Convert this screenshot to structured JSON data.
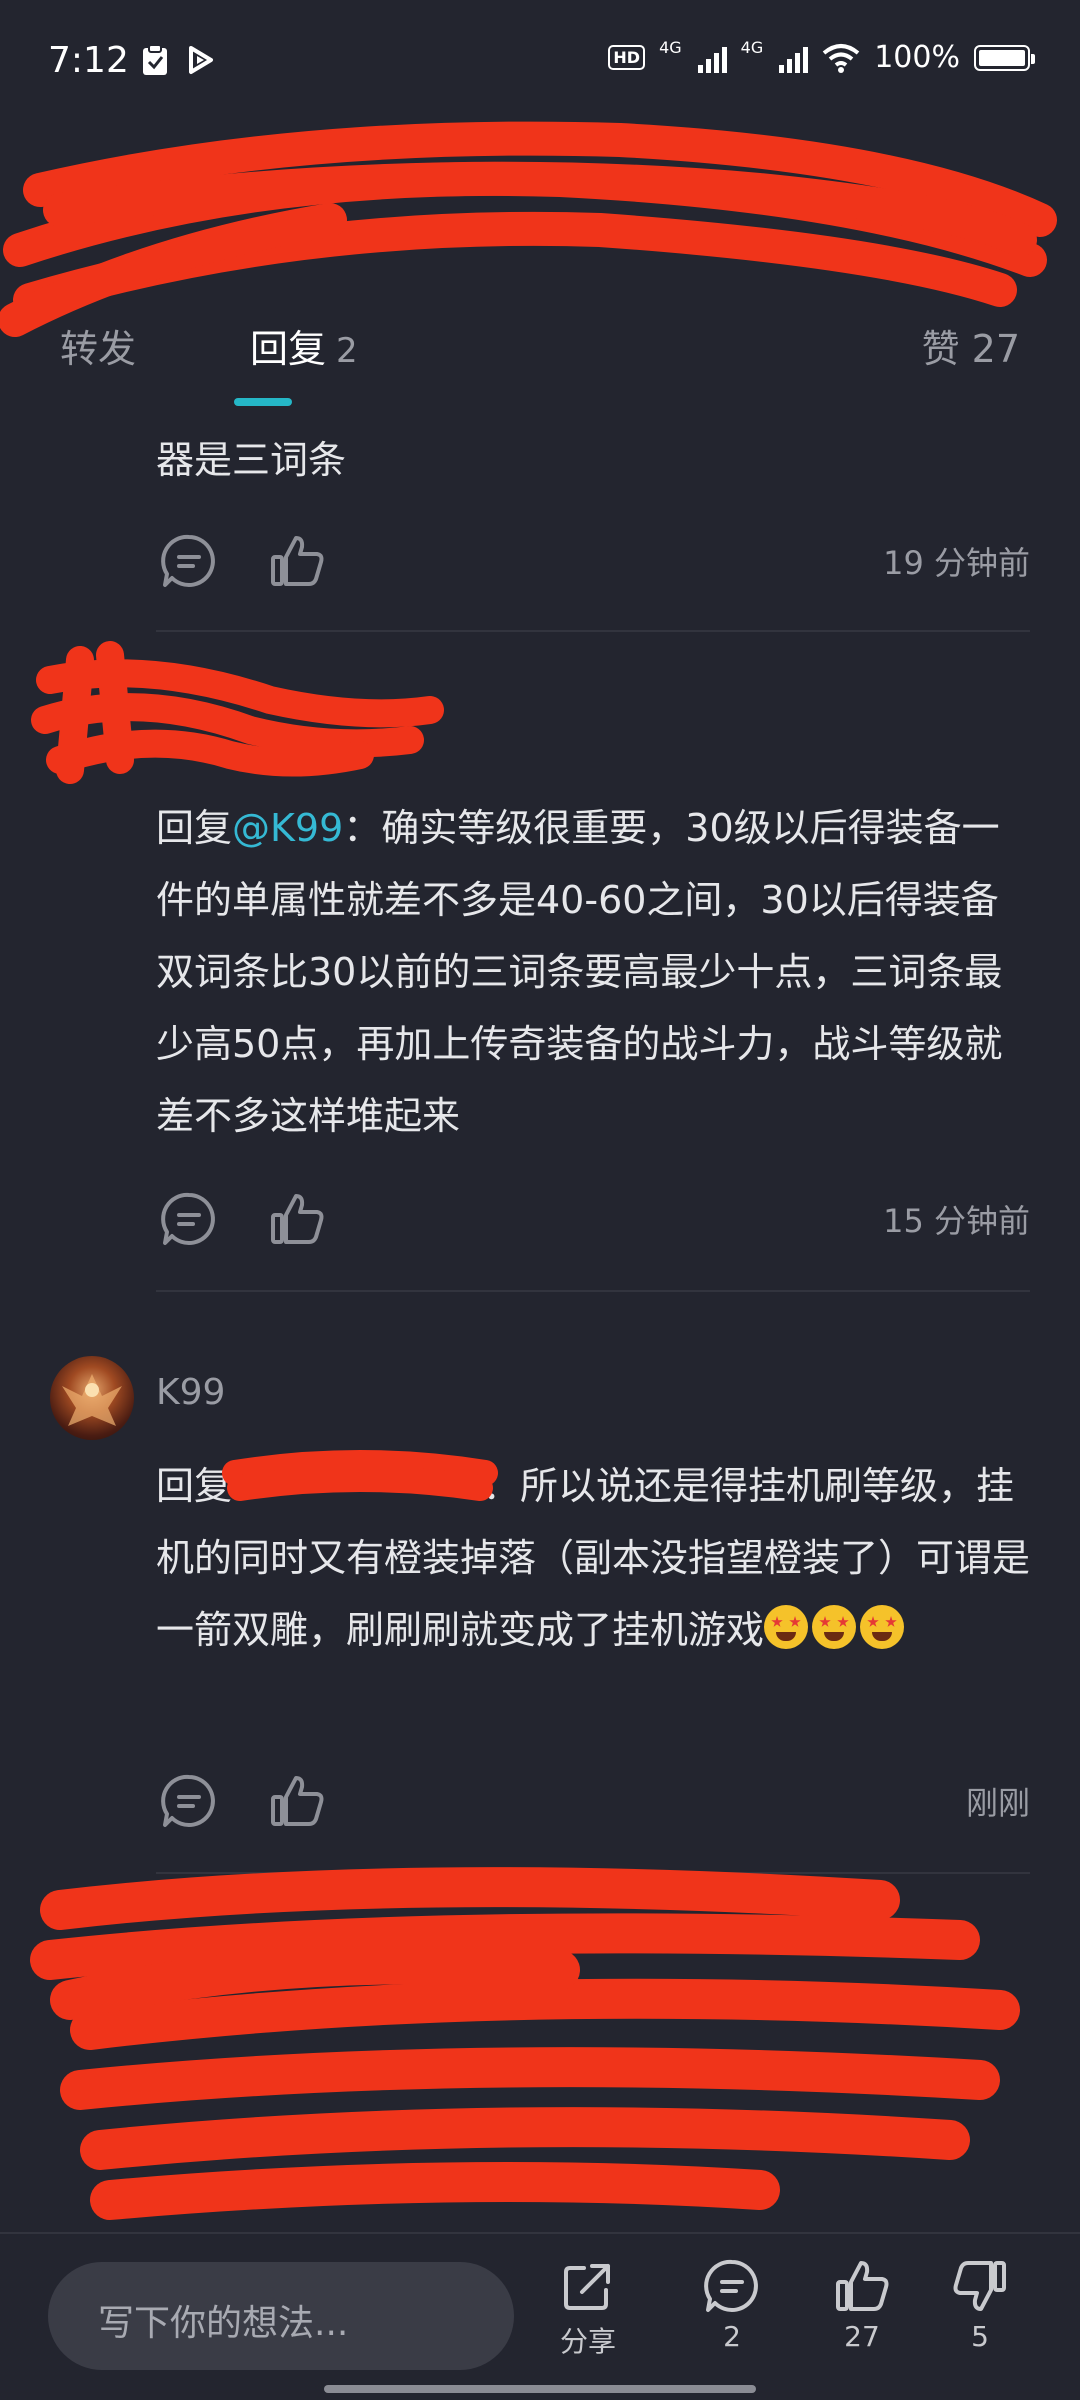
{
  "status_bar": {
    "time": "7:12",
    "battery": "100%",
    "network1": "4G",
    "network2": "4G",
    "hd": "HD"
  },
  "tabs": {
    "forward_label": "转发",
    "reply_label": "回复",
    "reply_count": "2",
    "likes_label": "赞 27"
  },
  "comments": [
    {
      "text": "器是三词条",
      "time": "19 分钟前"
    },
    {
      "reply_prefix": "回复",
      "mention": "@K99",
      "text": "：确实等级很重要，30级以后得装备一件的单属性就差不多是40-60之间，30以后得装备双词条比30以前的三词条要高最少十点，三词条最少高50点，再加上传奇装备的战斗力，战斗等级就差不多这样堆起来",
      "time": "15 分钟前"
    },
    {
      "username": "K99",
      "reply_prefix": "回复",
      "text": "：所以说还是得挂机刷等级，挂机的同时又有橙装掉落（副本没指望橙装了）可谓是一箭双雕，刷刷刷就变成了挂机游戏",
      "time": "刚刚"
    }
  ],
  "bottom_bar": {
    "input_placeholder": "写下你的想法...",
    "share_label": "分享",
    "comment_count": "2",
    "like_count": "27",
    "dislike_count": "5"
  },
  "colors": {
    "background": "#23252f",
    "accent": "#25b7c7",
    "mention": "#35b9d4",
    "redaction": "#f0341a"
  }
}
